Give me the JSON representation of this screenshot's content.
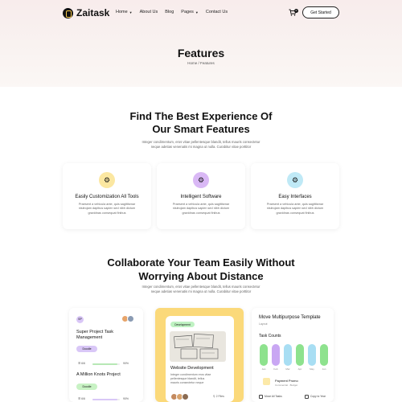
{
  "header": {
    "brand": "Zaitask",
    "nav": [
      {
        "label": "Home",
        "dropdown": true
      },
      {
        "label": "About Us",
        "dropdown": false
      },
      {
        "label": "Blog",
        "dropdown": false
      },
      {
        "label": "Pages",
        "dropdown": true
      },
      {
        "label": "Contact Us",
        "dropdown": false
      }
    ],
    "cart_count": "0",
    "cta": "Get Started"
  },
  "hero": {
    "title": "Features",
    "breadcrumb": "Home / Features"
  },
  "features_section": {
    "title_line1": "Find The Best Experience Of",
    "title_line2": "Our Smart Features",
    "desc_line1": "Integer condimentum, eros vitae pellentesque blandit, tellus mauris consectetur",
    "desc_line2": "neque adetias venenatis mi magna ut nulla. Curabitur vitae porttitor",
    "cards": [
      {
        "title": "Easily Customization All Tools",
        "icon": "gear-icon",
        "color": "#fbe7a1",
        "desc": [
          "Praesent a vehicula ante, quis sagittismar",
          "nisleojam dapibus sapien sed nibh dictum",
          "gravidnas consequat finibus"
        ]
      },
      {
        "title": "Intelligent Software",
        "icon": "gear-icon",
        "color": "#d9b8f5",
        "desc": [
          "Praesent a vehicula ante, quis sagittismar",
          "nisleojam dapibus sapien sed nibh dictum",
          "gravidnas consequat finibus"
        ]
      },
      {
        "title": "Easy Interfaces",
        "icon": "gear-icon",
        "color": "#bfe9f6",
        "desc": [
          "Praesent a vehicula ante, quis sagittismar",
          "nisleojam dapibus sapien sed nibh dictum",
          "gravidnas consequat finibus"
        ]
      }
    ]
  },
  "collab_section": {
    "title_line1": "Collaborate Your Team Easily Without",
    "title_line2": "Worrying About Distance",
    "desc_line1": "Integer condimentum, eros vitae pellentesque blandit, tellus mauris consectetur",
    "desc_line2": "neque adetias venenatis mi magna ut nulla. Curabitur vitae porttitor"
  },
  "project_card": {
    "chip": "SP",
    "task1": {
      "title_line1": "Super Project Task",
      "title_line2": "Management",
      "tag": "Doodle",
      "count": "6/6",
      "progress": "90%",
      "progress_value": 0.9
    },
    "task2": {
      "title": "A Million Knots Project",
      "tag": "Doodle",
      "count": "6/6",
      "progress": "90%",
      "progress_value": 0.9
    }
  },
  "dev_card": {
    "tag": "Development",
    "title": "Website Development",
    "desc_lines": [
      "Integer condimentum eros vitae",
      "pellentesque blandit, tellus",
      "mauris consectetur neque"
    ],
    "meta": "2 Files"
  },
  "stats_card": {
    "title": "Move Multipurpose  Template",
    "subtitle": "Layout",
    "task_counts": "Task Counts",
    "bars": [
      {
        "label": "Jan",
        "value": 0.75,
        "color": "#8ee28e"
      },
      {
        "label": "Feb",
        "value": 0.75,
        "color": "#c9a7f3"
      },
      {
        "label": "Mar",
        "value": 0.75,
        "color": "#a8def3"
      },
      {
        "label": "Apr",
        "value": 0.75,
        "color": "#8ee28e"
      },
      {
        "label": "May",
        "value": 0.75,
        "color": "#a8def3"
      },
      {
        "label": "Jun",
        "value": 0.75,
        "color": "#8ee28e"
      }
    ],
    "payment_title": "Payment Promo",
    "payment_sub": "Commercial · Budget",
    "check1": "Move All Tasks",
    "check2": "Copy to Year"
  }
}
